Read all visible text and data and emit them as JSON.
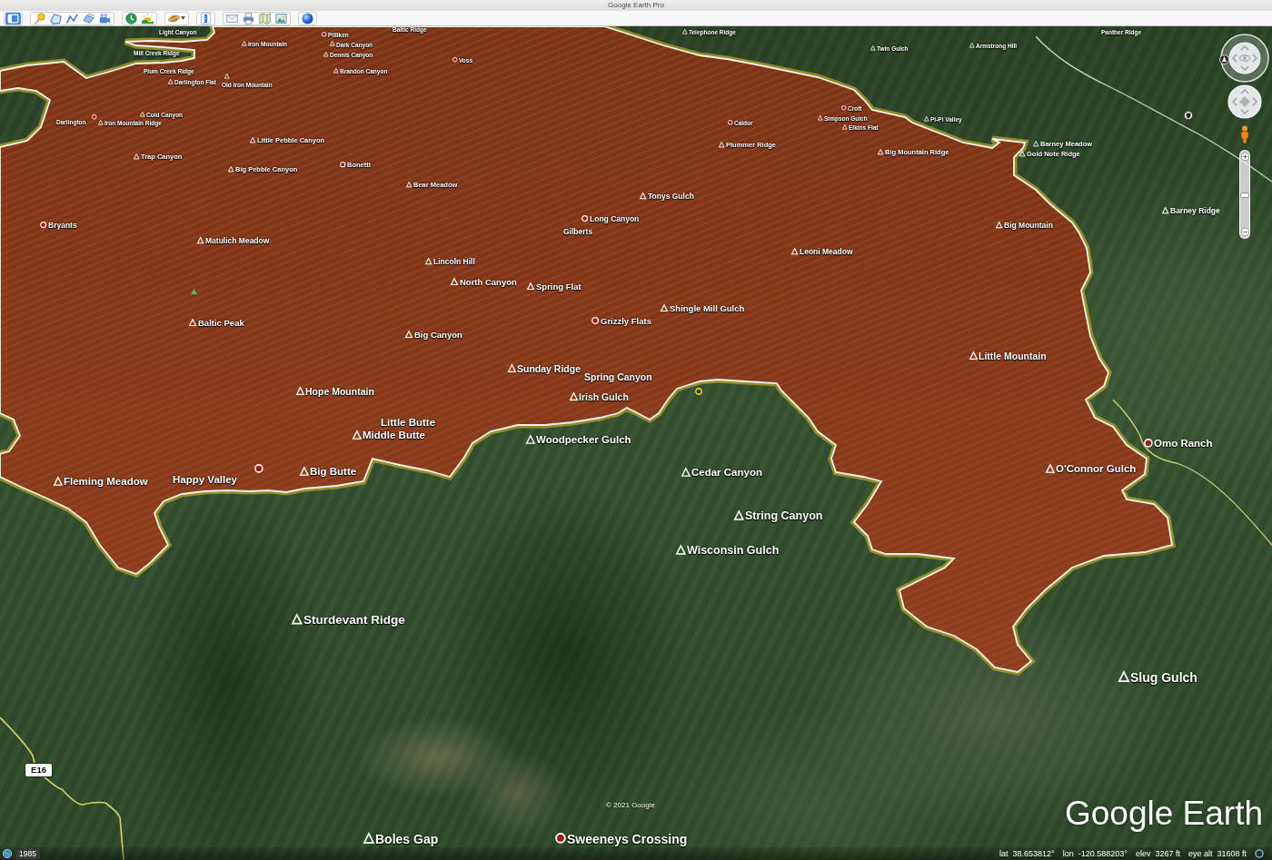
{
  "window": {
    "title": "Google Earth Pro"
  },
  "toolbar": {
    "groups": [
      [
        {
          "kind": "sidebar",
          "on": true
        }
      ],
      [
        {
          "kind": "pin",
          "on": false
        },
        {
          "kind": "polygon",
          "on": false
        },
        {
          "kind": "path",
          "on": false
        },
        {
          "kind": "overlay",
          "on": false
        },
        {
          "kind": "tour",
          "on": false
        }
      ],
      [
        {
          "kind": "clock",
          "on": false
        },
        {
          "kind": "sun",
          "on": false
        }
      ],
      [
        {
          "kind": "planet",
          "on": false
        }
      ],
      [
        {
          "kind": "ruler",
          "on": false
        }
      ],
      [
        {
          "kind": "mail",
          "on": false
        },
        {
          "kind": "print",
          "on": false
        },
        {
          "kind": "map",
          "on": false
        },
        {
          "kind": "image",
          "on": false
        }
      ],
      [
        {
          "kind": "globe",
          "on": false
        }
      ]
    ]
  },
  "map": {
    "placemarks": [
      {
        "label": "Light Canyon",
        "kind": "label"
      },
      {
        "label": "Pilliken",
        "kind": "circle"
      },
      {
        "label": "Baltic Ridge",
        "kind": "label"
      },
      {
        "label": "Telephone Ridge",
        "kind": "triangle"
      },
      {
        "label": "Panther Ridge",
        "kind": "label"
      },
      {
        "label": "Iron Mountain",
        "kind": "triangle"
      },
      {
        "label": "Dark Canyon",
        "kind": "triangle"
      },
      {
        "label": "Twin Gulch",
        "kind": "triangle"
      },
      {
        "label": "Armstrong Hill",
        "kind": "triangle"
      },
      {
        "label": "Mill Creek Ridge",
        "kind": "label"
      },
      {
        "label": "Dennis Canyon",
        "kind": "triangle"
      },
      {
        "label": "Voss",
        "kind": "circle"
      },
      {
        "label": "Plum Creek Ridge",
        "kind": "label"
      },
      {
        "label": "Brandon Canyon",
        "kind": "triangle"
      },
      {
        "label": "Darlington Flat",
        "kind": "triangle"
      },
      {
        "label": "Old Iron Mountain",
        "kind": "triangle"
      },
      {
        "label": "Darlington",
        "kind": "circle"
      },
      {
        "label": "Iron Mountain Ridge",
        "kind": "triangle"
      },
      {
        "label": "Cold Canyon",
        "kind": "triangle"
      },
      {
        "label": "Caldor",
        "kind": "circle"
      },
      {
        "label": "Croft",
        "kind": "circle"
      },
      {
        "label": "Simpson Gulch",
        "kind": "triangle"
      },
      {
        "label": "Pi-Pi Valley",
        "kind": "triangle"
      },
      {
        "label": "Elkins Flat",
        "kind": "triangle"
      },
      {
        "label": "Little Pebble Canyon",
        "kind": "triangle"
      },
      {
        "label": "Plummer Ridge",
        "kind": "triangle"
      },
      {
        "label": "Barney Meadow",
        "kind": "triangle"
      },
      {
        "label": "Trap Canyon",
        "kind": "triangle"
      },
      {
        "label": "Big Mountain Ridge",
        "kind": "triangle"
      },
      {
        "label": "Gold Note Ridge",
        "kind": "triangle"
      },
      {
        "label": "Big Pebble Canyon",
        "kind": "triangle"
      },
      {
        "label": "Bonetti",
        "kind": "circle"
      },
      {
        "label": "Bear Meadow",
        "kind": "triangle"
      },
      {
        "label": "Tonys Gulch",
        "kind": "triangle"
      },
      {
        "label": "Barney Ridge",
        "kind": "triangle"
      },
      {
        "label": "Bryants",
        "kind": "circle"
      },
      {
        "label": "Long Canyon",
        "kind": "circle"
      },
      {
        "label": "Gilberts",
        "kind": "label"
      },
      {
        "label": "Big Mountain",
        "kind": "triangle"
      },
      {
        "label": "Matulich Meadow",
        "kind": "triangle"
      },
      {
        "label": "Leoni Meadow",
        "kind": "triangle"
      },
      {
        "label": "Lincoln Hill",
        "kind": "triangle"
      },
      {
        "label": "North Canyon",
        "kind": "triangle"
      },
      {
        "label": "Spring Flat",
        "kind": "triangle"
      },
      {
        "label": "Shingle Mill Gulch",
        "kind": "triangle"
      },
      {
        "label": "Baltic Peak",
        "kind": "triangle"
      },
      {
        "label": "Grizzly Flats",
        "kind": "circle"
      },
      {
        "label": "Big Canyon",
        "kind": "triangle"
      },
      {
        "label": "Little Mountain",
        "kind": "triangle"
      },
      {
        "label": "Sunday Ridge",
        "kind": "triangle"
      },
      {
        "label": "Spring Canyon",
        "kind": "label"
      },
      {
        "label": "Hope Mountain",
        "kind": "triangle"
      },
      {
        "label": "Irish Gulch",
        "kind": "triangle"
      },
      {
        "label": "Little Butte",
        "kind": "label"
      },
      {
        "label": "Middle Butte",
        "kind": "triangle"
      },
      {
        "label": "Woodpecker Gulch",
        "kind": "triangle"
      },
      {
        "label": "Omo Ranch",
        "kind": "circle"
      },
      {
        "label": "Fleming Meadow",
        "kind": "triangle"
      },
      {
        "label": "Happy Valley",
        "kind": "circle"
      },
      {
        "label": "Big Butte",
        "kind": "triangle"
      },
      {
        "label": "Cedar Canyon",
        "kind": "triangle"
      },
      {
        "label": "O'Connor Gulch",
        "kind": "triangle"
      },
      {
        "label": "String Canyon",
        "kind": "triangle"
      },
      {
        "label": "Wisconsin Gulch",
        "kind": "triangle"
      },
      {
        "label": "Sturdevant Ridge",
        "kind": "triangle"
      },
      {
        "label": "Slug Gulch",
        "kind": "triangle"
      },
      {
        "label": "Boles Gap",
        "kind": "triangle"
      },
      {
        "label": "Sweeneys Crossing",
        "kind": "circle"
      }
    ],
    "route_shield": "E16",
    "attribution": "© 2021 Google",
    "logo": "Google Earth",
    "imagery_year": "1985"
  },
  "navigation": {
    "zoom_slider": {
      "level": 0.5
    }
  },
  "status_bar": {
    "readings": [
      {
        "label": "lat",
        "value": "38.653812°"
      },
      {
        "label": "lon",
        "value": "-120.588203°"
      },
      {
        "label": "elev",
        "value": "3267 ft"
      },
      {
        "label": "eye alt",
        "value": "31608 ft"
      }
    ]
  }
}
